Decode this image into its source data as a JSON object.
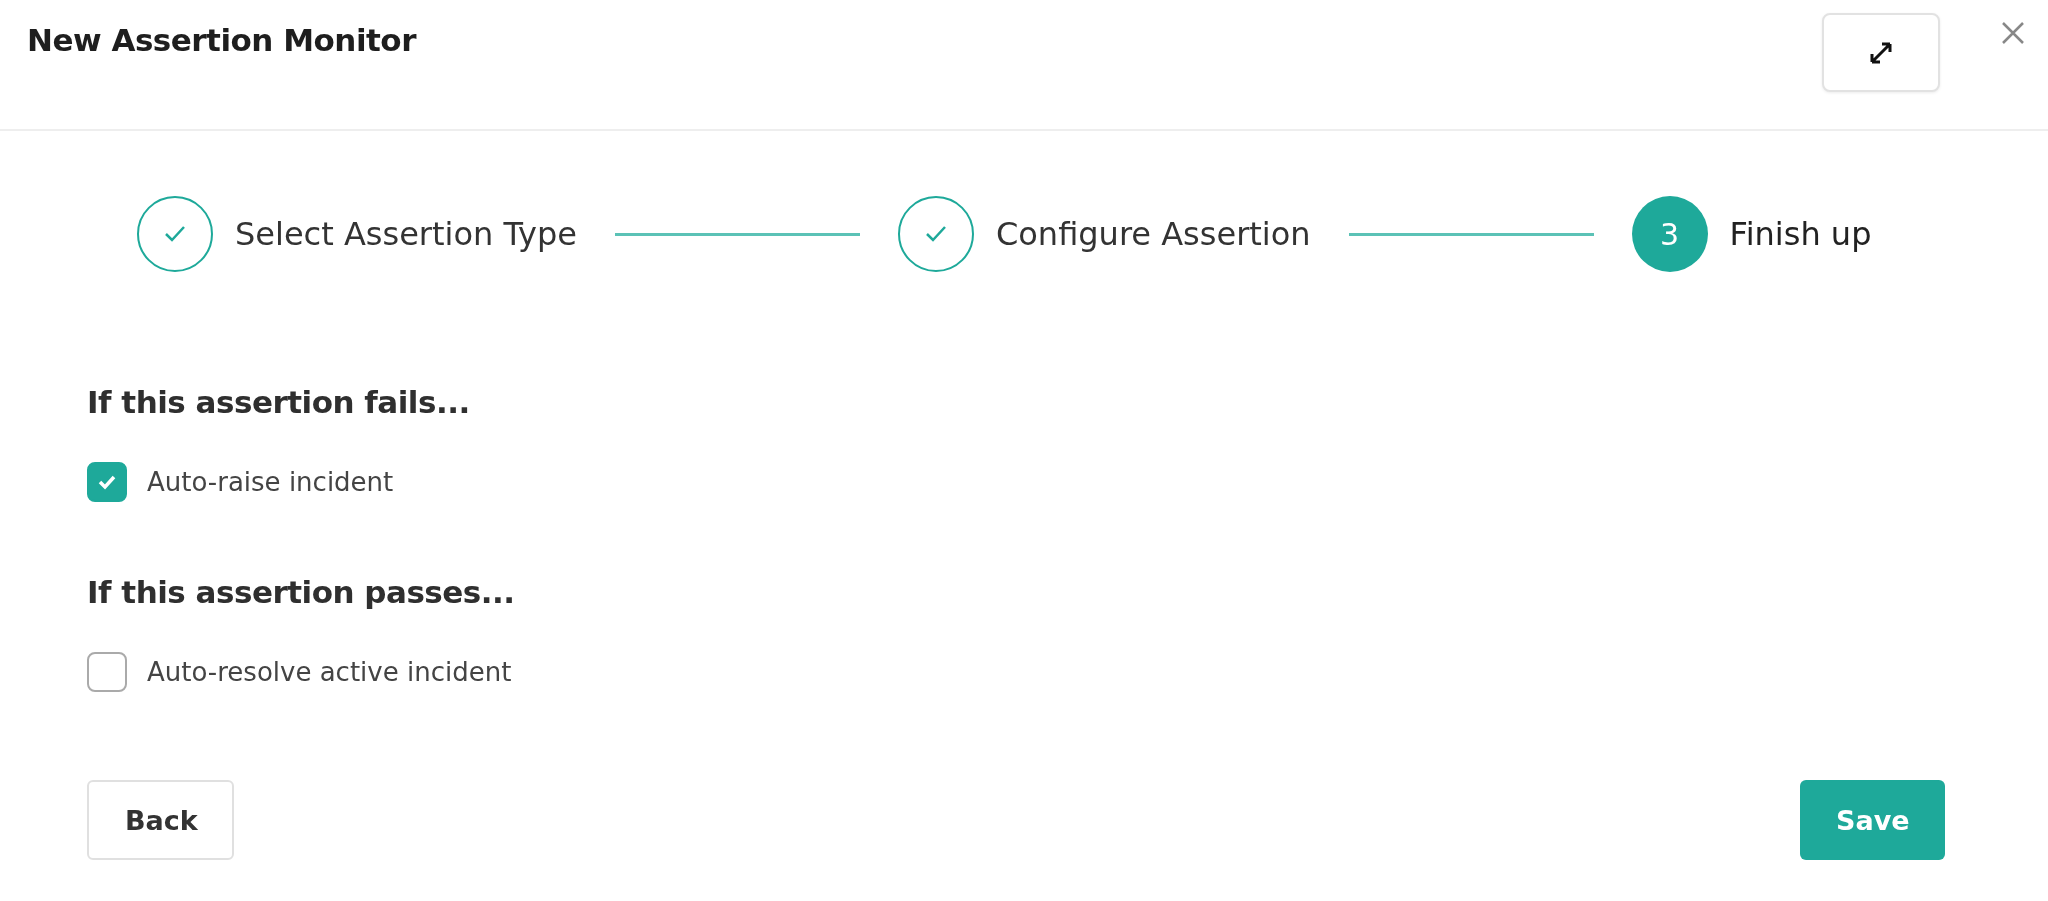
{
  "dialog": {
    "title": "New Assertion Monitor"
  },
  "steps": [
    {
      "label": "Select Assertion Type",
      "completed": true,
      "current": false
    },
    {
      "label": "Configure Assertion",
      "completed": true,
      "current": false
    },
    {
      "number": "3",
      "label": "Finish up",
      "completed": false,
      "current": true
    }
  ],
  "sections": [
    {
      "heading": "If this assertion fails...",
      "option": {
        "label": "Auto-raise incident",
        "checked": true
      }
    },
    {
      "heading": "If this assertion passes...",
      "option": {
        "label": "Auto-resolve active incident",
        "checked": false
      }
    }
  ],
  "buttons": {
    "back": "Back",
    "save": "Save"
  }
}
